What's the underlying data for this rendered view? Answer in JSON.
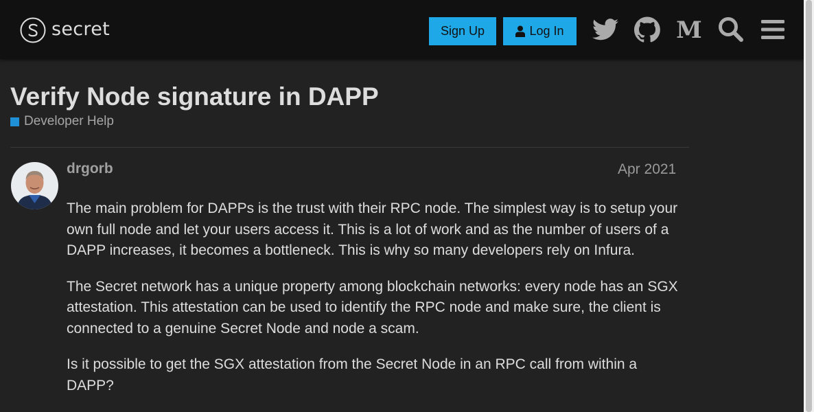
{
  "header": {
    "logo_text": "secret",
    "signup_label": "Sign Up",
    "login_label": "Log In",
    "icons": [
      "twitter-icon",
      "github-icon",
      "medium-icon",
      "search-icon",
      "menu-icon"
    ]
  },
  "topic": {
    "title": "Verify Node signature in DAPP",
    "category": "Developer Help",
    "category_color": "#1f8fd6"
  },
  "post": {
    "username": "drgorb",
    "date": "Apr 2021",
    "paragraphs": [
      "The main problem for DAPPs is the trust with their RPC node. The simplest way is to setup your own full node and let your users access it. This is a lot of work and as the number of users of a DAPP increases, it becomes a bottleneck. This is why so many developers rely on Infura.",
      "The Secret network has a unique property among blockchain networks: every node has an SGX attestation. This attestation can be used to identify the RPC node and make sure, the client is connected to a genuine Secret Node and node a scam.",
      "Is it possible to get the SGX attestation from the Secret Node in an RPC call from within a DAPP?"
    ]
  },
  "colors": {
    "header_bg": "#111111",
    "page_bg": "#222222",
    "accent": "#1fa8e8"
  }
}
